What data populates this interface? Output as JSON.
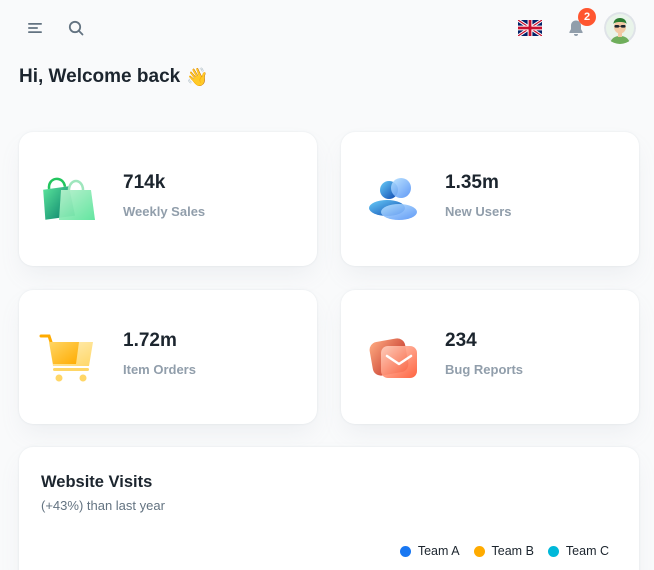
{
  "header": {
    "notifications_count": "2"
  },
  "welcome": {
    "text": "Hi, Welcome back",
    "emoji": "👋"
  },
  "stats": [
    {
      "value": "714k",
      "label": "Weekly Sales",
      "icon": "shopping-bag-icon",
      "color": "#22c55e"
    },
    {
      "value": "1.35m",
      "label": "New Users",
      "icon": "users-icon",
      "color": "#1877f2"
    },
    {
      "value": "1.72m",
      "label": "Item Orders",
      "icon": "cart-icon",
      "color": "#ffab00"
    },
    {
      "value": "234",
      "label": "Bug Reports",
      "icon": "mail-icon",
      "color": "#ff5630"
    }
  ],
  "visits": {
    "title": "Website Visits",
    "subtitle": "(+43%) than last year",
    "legend": [
      {
        "name": "Team A",
        "color": "#1877f2"
      },
      {
        "name": "Team B",
        "color": "#ffab00"
      },
      {
        "name": "Team C",
        "color": "#00b8d9"
      }
    ]
  }
}
